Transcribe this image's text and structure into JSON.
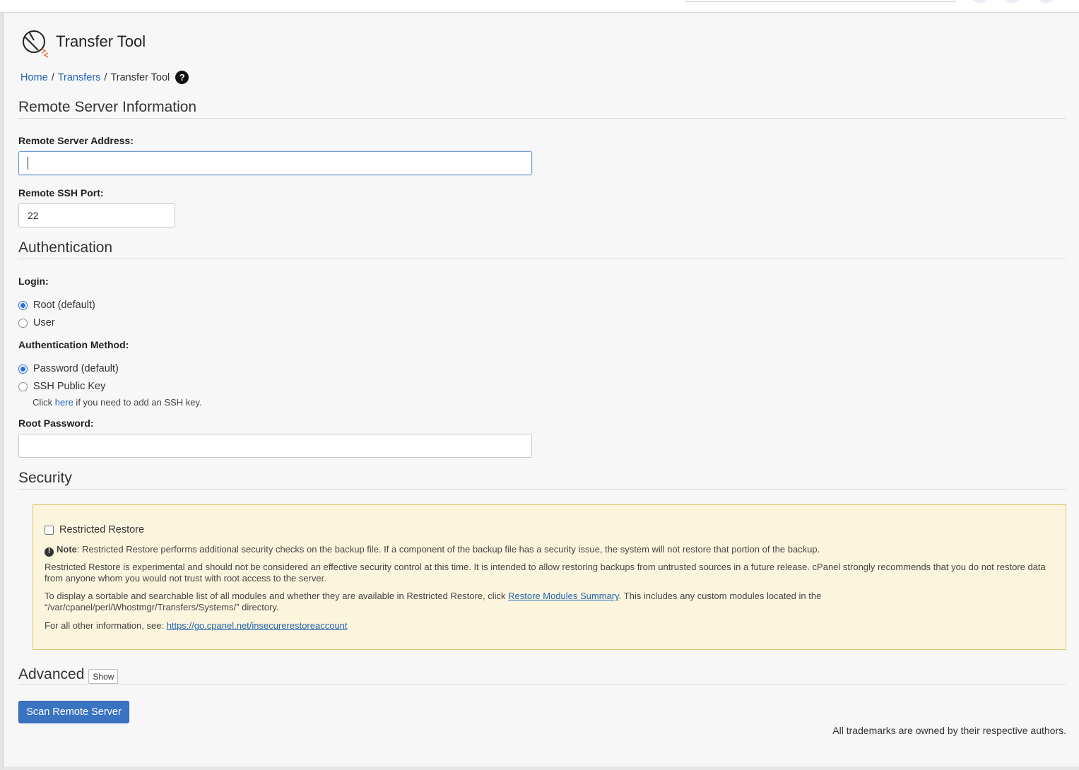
{
  "page": {
    "title": "Transfer Tool"
  },
  "breadcrumb": {
    "home": "Home",
    "separator": "/",
    "transfers": "Transfers",
    "current": "Transfer Tool",
    "help_glyph": "?"
  },
  "remote_server": {
    "heading": "Remote Server Information",
    "address_label": "Remote Server Address:",
    "address_value": "",
    "port_label": "Remote SSH Port:",
    "port_value": "22"
  },
  "authentication": {
    "heading": "Authentication",
    "login_label": "Login:",
    "login_options": [
      {
        "label": "Root (default)",
        "checked": true
      },
      {
        "label": "User",
        "checked": false
      }
    ],
    "method_label": "Authentication Method:",
    "method_options": [
      {
        "label": "Password (default)",
        "checked": true
      },
      {
        "label": "SSH Public Key",
        "checked": false
      }
    ],
    "ssh_hint_prefix": "Click ",
    "ssh_hint_link": "here",
    "ssh_hint_suffix": " if you need to add an SSH key.",
    "password_label": "Root Password:",
    "password_value": ""
  },
  "security": {
    "heading": "Security",
    "restricted_restore_label": "Restricted Restore",
    "restricted_restore_checked": false,
    "note_glyph": "!",
    "note_bold": "Note",
    "note_text": ": Restricted Restore performs additional security checks on the backup file. If a component of the backup file has a security issue, the system will not restore that portion of the backup.",
    "experimental_text": "Restricted Restore is experimental and should not be considered an effective security control at this time. It is intended to allow restoring backups from untrusted sources in a future release. cPanel strongly recommends that you do not restore data from anyone whom you would not trust with root access to the server.",
    "modules_prefix": "To display a sortable and searchable list of all modules and whether they are available in Restricted Restore, click ",
    "modules_link": "Restore Modules Summary",
    "modules_suffix": ". This includes any custom modules located in the “/var/cpanel/perl/Whostmgr/Transfers/Systems/” directory.",
    "info_prefix": "For all other information, see: ",
    "info_link": "https://go.cpanel.net/insecurerestoreaccount"
  },
  "advanced": {
    "heading": "Advanced",
    "show_label": "Show"
  },
  "actions": {
    "scan_label": "Scan Remote Server"
  },
  "footer": {
    "trademark": "All trademarks are owned by their respective authors."
  },
  "colors": {
    "link": "#1f63b0",
    "primary_button": "#3a73c2",
    "warning_bg": "#fcf5dd",
    "warning_border": "#e4c46a",
    "radio_checked": "#2f6fd8"
  },
  "icons": {
    "page_icon": "transfer-tool-icon",
    "help_icon": "question-circle-icon",
    "note_icon": "exclamation-circle-icon"
  }
}
